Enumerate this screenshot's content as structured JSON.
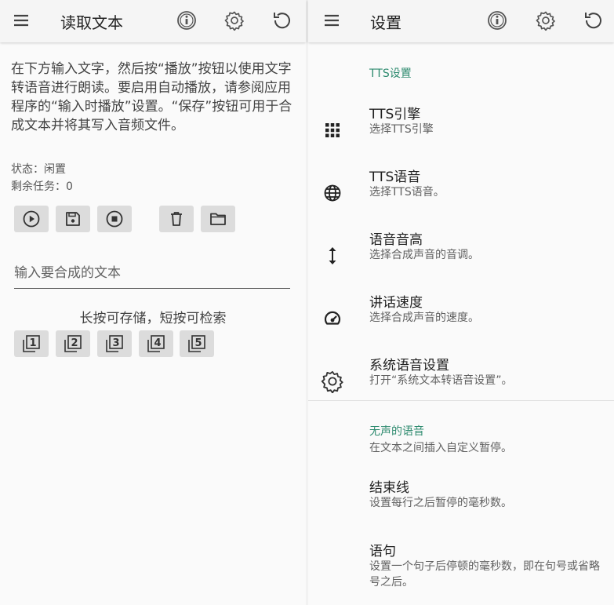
{
  "left": {
    "title": "读取文本",
    "icons": [
      "menu-icon",
      "info-icon",
      "settings-icon",
      "undo-icon"
    ],
    "intro": "在下方输入文字，然后按“播放”按钮以使用文字转语音进行朗读。要启用自动播放，请参阅应用程序的“输入时播放”设置。“保存”按钮可用于合成文本并将其写入音频文件。",
    "status": "状态：闲置",
    "tasks": "剩余任务：0",
    "controls": [
      "play-icon",
      "save-icon",
      "stop-icon",
      "delete-icon",
      "folder-icon"
    ],
    "input_placeholder": "输入要合成的文本",
    "hint": "长按可存储，短按可检索",
    "slots": [
      "1",
      "2",
      "3",
      "4",
      "5"
    ]
  },
  "right": {
    "title": "设置",
    "icons": [
      "menu-icon",
      "info-icon",
      "settings-icon",
      "undo-icon"
    ],
    "section1": "TTS设置",
    "items": [
      {
        "title": "TTS引擎",
        "subtitle": "选择TTS引擎",
        "icon": "grid-icon"
      },
      {
        "title": "TTS语音",
        "subtitle": "选择TTS语音。",
        "icon": "globe-icon"
      },
      {
        "title": "语音音高",
        "subtitle": "选择合成声音的音调。",
        "icon": "vertical-arrows-icon"
      },
      {
        "title": "讲话速度",
        "subtitle": "选择合成声音的速度。",
        "icon": "speedometer-icon"
      },
      {
        "title": "系统语音设置",
        "subtitle": "打开“系统文本转语音设置”。",
        "icon": "gear-icon"
      }
    ],
    "section2": "无声的语音",
    "section2_desc": "在文本之间插入自定义暂停。",
    "items2": [
      {
        "title": "结束线",
        "subtitle": "设置每行之后暂停的毫秒数。"
      },
      {
        "title": "语句",
        "subtitle": "设置一个句子后停顿的毫秒数，即在句号或省略号之后。"
      }
    ]
  }
}
